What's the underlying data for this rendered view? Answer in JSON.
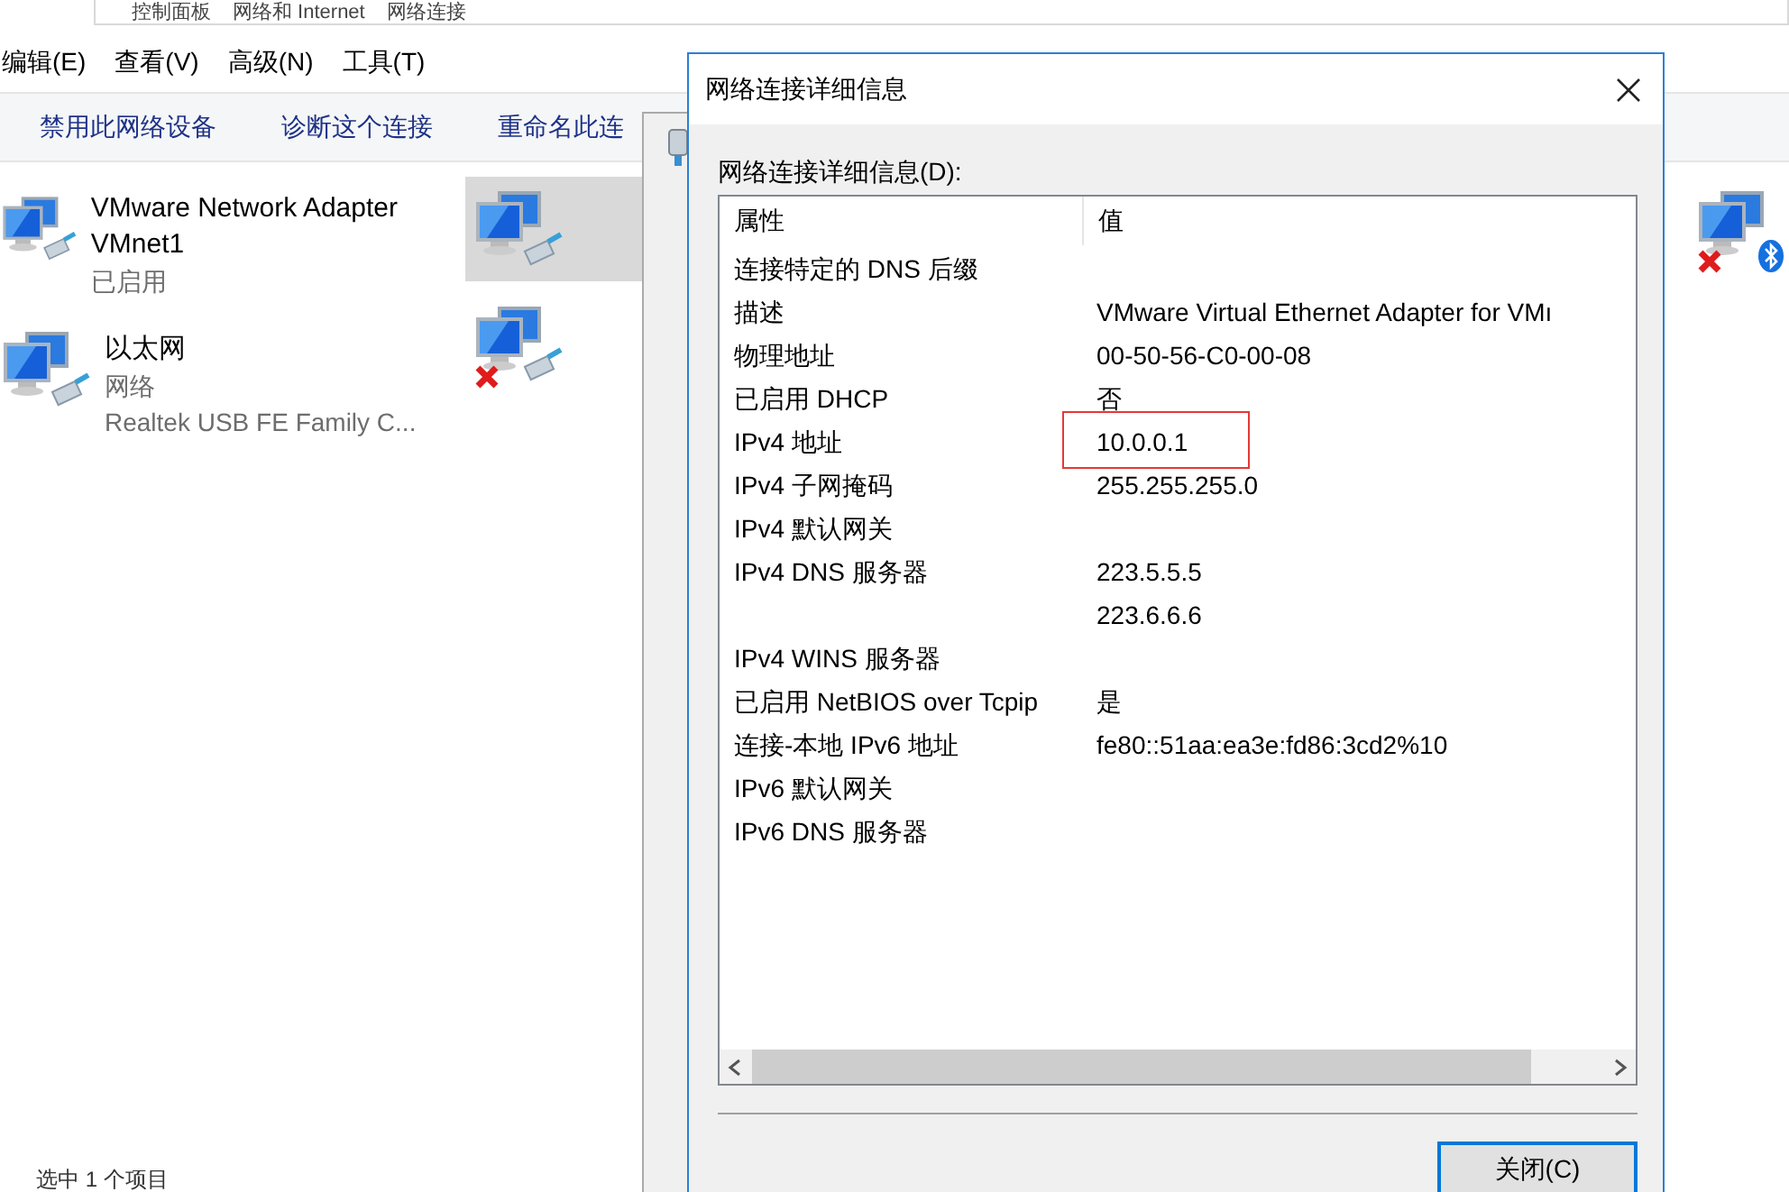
{
  "explorer": {
    "breadcrumb": [
      "控制面板",
      "网络和 Internet",
      "网络连接"
    ],
    "menu": [
      "编辑(E)",
      "查看(V)",
      "高级(N)",
      "工具(T)"
    ],
    "toolbar": [
      "禁用此网络设备",
      "诊断这个连接",
      "重命名此连"
    ],
    "adapters": [
      {
        "name": "VMware Network Adapter VMnet1",
        "lines": [
          "已启用"
        ],
        "disconnected": false,
        "selected": false,
        "kind": "wired"
      },
      {
        "name": "以太网",
        "lines": [
          "网络",
          "Realtek USB FE Family C..."
        ],
        "disconnected": false,
        "selected": false,
        "kind": "wired"
      },
      {
        "disconnected": false,
        "selected": true,
        "kind": "wired"
      },
      {
        "disconnected": true,
        "selected": false,
        "kind": "wired"
      },
      {
        "disconnected": true,
        "selected": false,
        "kind": "bluetooth"
      }
    ],
    "status": "选中 1 个项目"
  },
  "dialog": {
    "title": "网络连接详细信息",
    "label": "网络连接详细信息(D):",
    "columns": [
      "属性",
      "值"
    ],
    "rows": [
      {
        "property": "连接特定的 DNS 后缀",
        "value": "",
        "highlighted": false
      },
      {
        "property": "描述",
        "value": "VMware Virtual Ethernet Adapter for VMı",
        "highlighted": false
      },
      {
        "property": "物理地址",
        "value": "00-50-56-C0-00-08",
        "highlighted": false
      },
      {
        "property": "已启用 DHCP",
        "value": "否",
        "highlighted": false
      },
      {
        "property": "IPv4 地址",
        "value": "10.0.0.1",
        "highlighted": true
      },
      {
        "property": "IPv4 子网掩码",
        "value": "255.255.255.0",
        "highlighted": false
      },
      {
        "property": "IPv4 默认网关",
        "value": "",
        "highlighted": false
      },
      {
        "property": "IPv4 DNS 服务器",
        "value": "223.5.5.5",
        "highlighted": false
      },
      {
        "property": "",
        "value": "223.6.6.6",
        "highlighted": false
      },
      {
        "property": "IPv4 WINS 服务器",
        "value": "",
        "highlighted": false
      },
      {
        "property": "已启用 NetBIOS over Tcpip",
        "value": "是",
        "highlighted": false
      },
      {
        "property": "连接-本地 IPv6 地址",
        "value": "fe80::51aa:ea3e:fd86:3cd2%10",
        "highlighted": false
      },
      {
        "property": "IPv6 默认网关",
        "value": "",
        "highlighted": false
      },
      {
        "property": "IPv6 DNS 服务器",
        "value": "",
        "highlighted": false
      }
    ],
    "close_button": "关闭(C)"
  }
}
